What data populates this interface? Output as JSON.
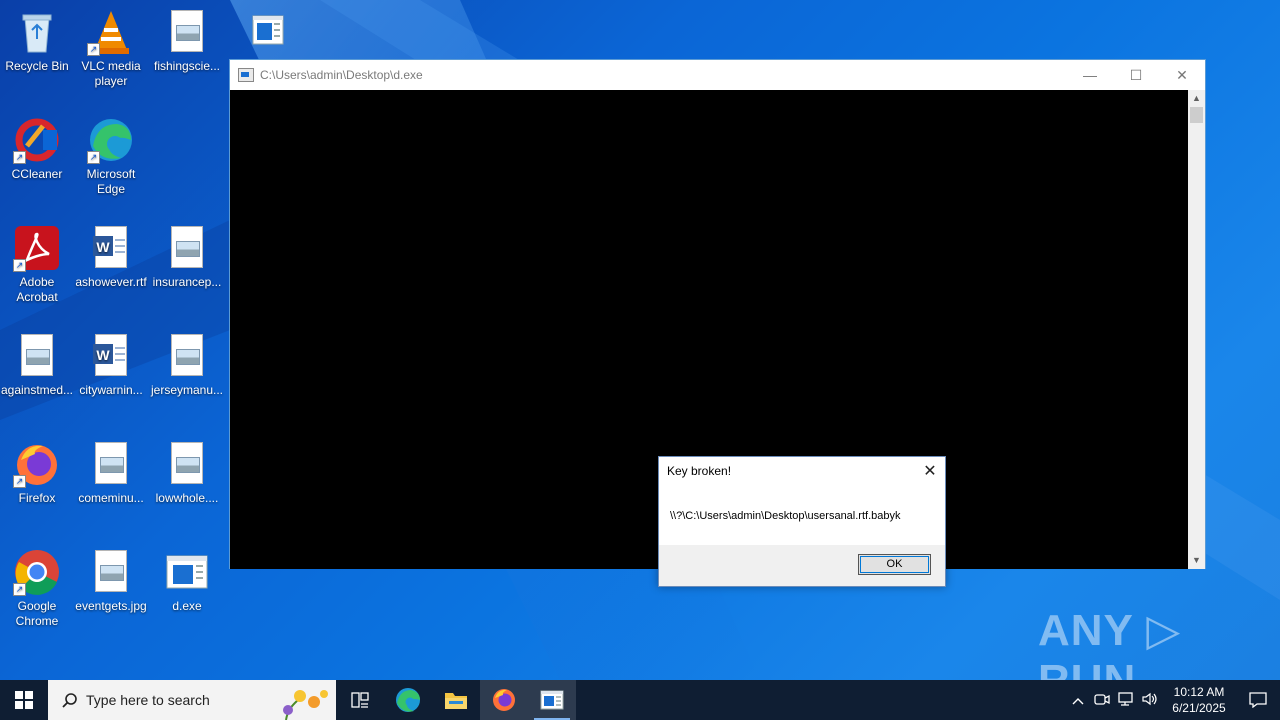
{
  "desktop": {
    "icons": [
      {
        "label": "Recycle Bin",
        "icon": "recycle-bin-icon"
      },
      {
        "label": "VLC media player",
        "icon": "vlc-icon"
      },
      {
        "label": "fishingscie...",
        "icon": "image-file-icon"
      },
      {
        "label": "CCleaner",
        "icon": "ccleaner-icon"
      },
      {
        "label": "Microsoft Edge",
        "icon": "edge-icon"
      },
      {
        "label": "Adobe Acrobat",
        "icon": "acrobat-icon"
      },
      {
        "label": "ashowever.rtf",
        "icon": "word-doc-icon"
      },
      {
        "label": "insurancep...",
        "icon": "image-file-icon"
      },
      {
        "label": "againstmed...",
        "icon": "image-file-icon"
      },
      {
        "label": "citywarnin...",
        "icon": "word-doc-icon"
      },
      {
        "label": "jerseymanu...",
        "icon": "image-file-icon"
      },
      {
        "label": "Firefox",
        "icon": "firefox-icon"
      },
      {
        "label": "comeminu...",
        "icon": "image-file-icon"
      },
      {
        "label": "lowwhole....",
        "icon": "image-file-icon"
      },
      {
        "label": "Google Chrome",
        "icon": "chrome-icon"
      },
      {
        "label": "eventgets.jpg",
        "icon": "image-file-icon"
      },
      {
        "label": "d.exe",
        "icon": "exe-icon"
      }
    ]
  },
  "console_window": {
    "title": "C:\\Users\\admin\\Desktop\\d.exe",
    "minimize": "—",
    "maximize": "☐",
    "close": "✕"
  },
  "dialog": {
    "title": "Key broken!",
    "message": "\\\\?\\C:\\Users\\admin\\Desktop\\usersanal.rtf.babyk",
    "ok_label": "OK",
    "close": "✕"
  },
  "watermark": "ANY ▷ RUN",
  "taskbar": {
    "search_placeholder": "Type here to search",
    "time": "10:12 AM",
    "date": "6/21/2025"
  },
  "colors": {
    "desktop_accent": "#0b66d6",
    "taskbar": "#0f1e33",
    "console": "#000000"
  }
}
